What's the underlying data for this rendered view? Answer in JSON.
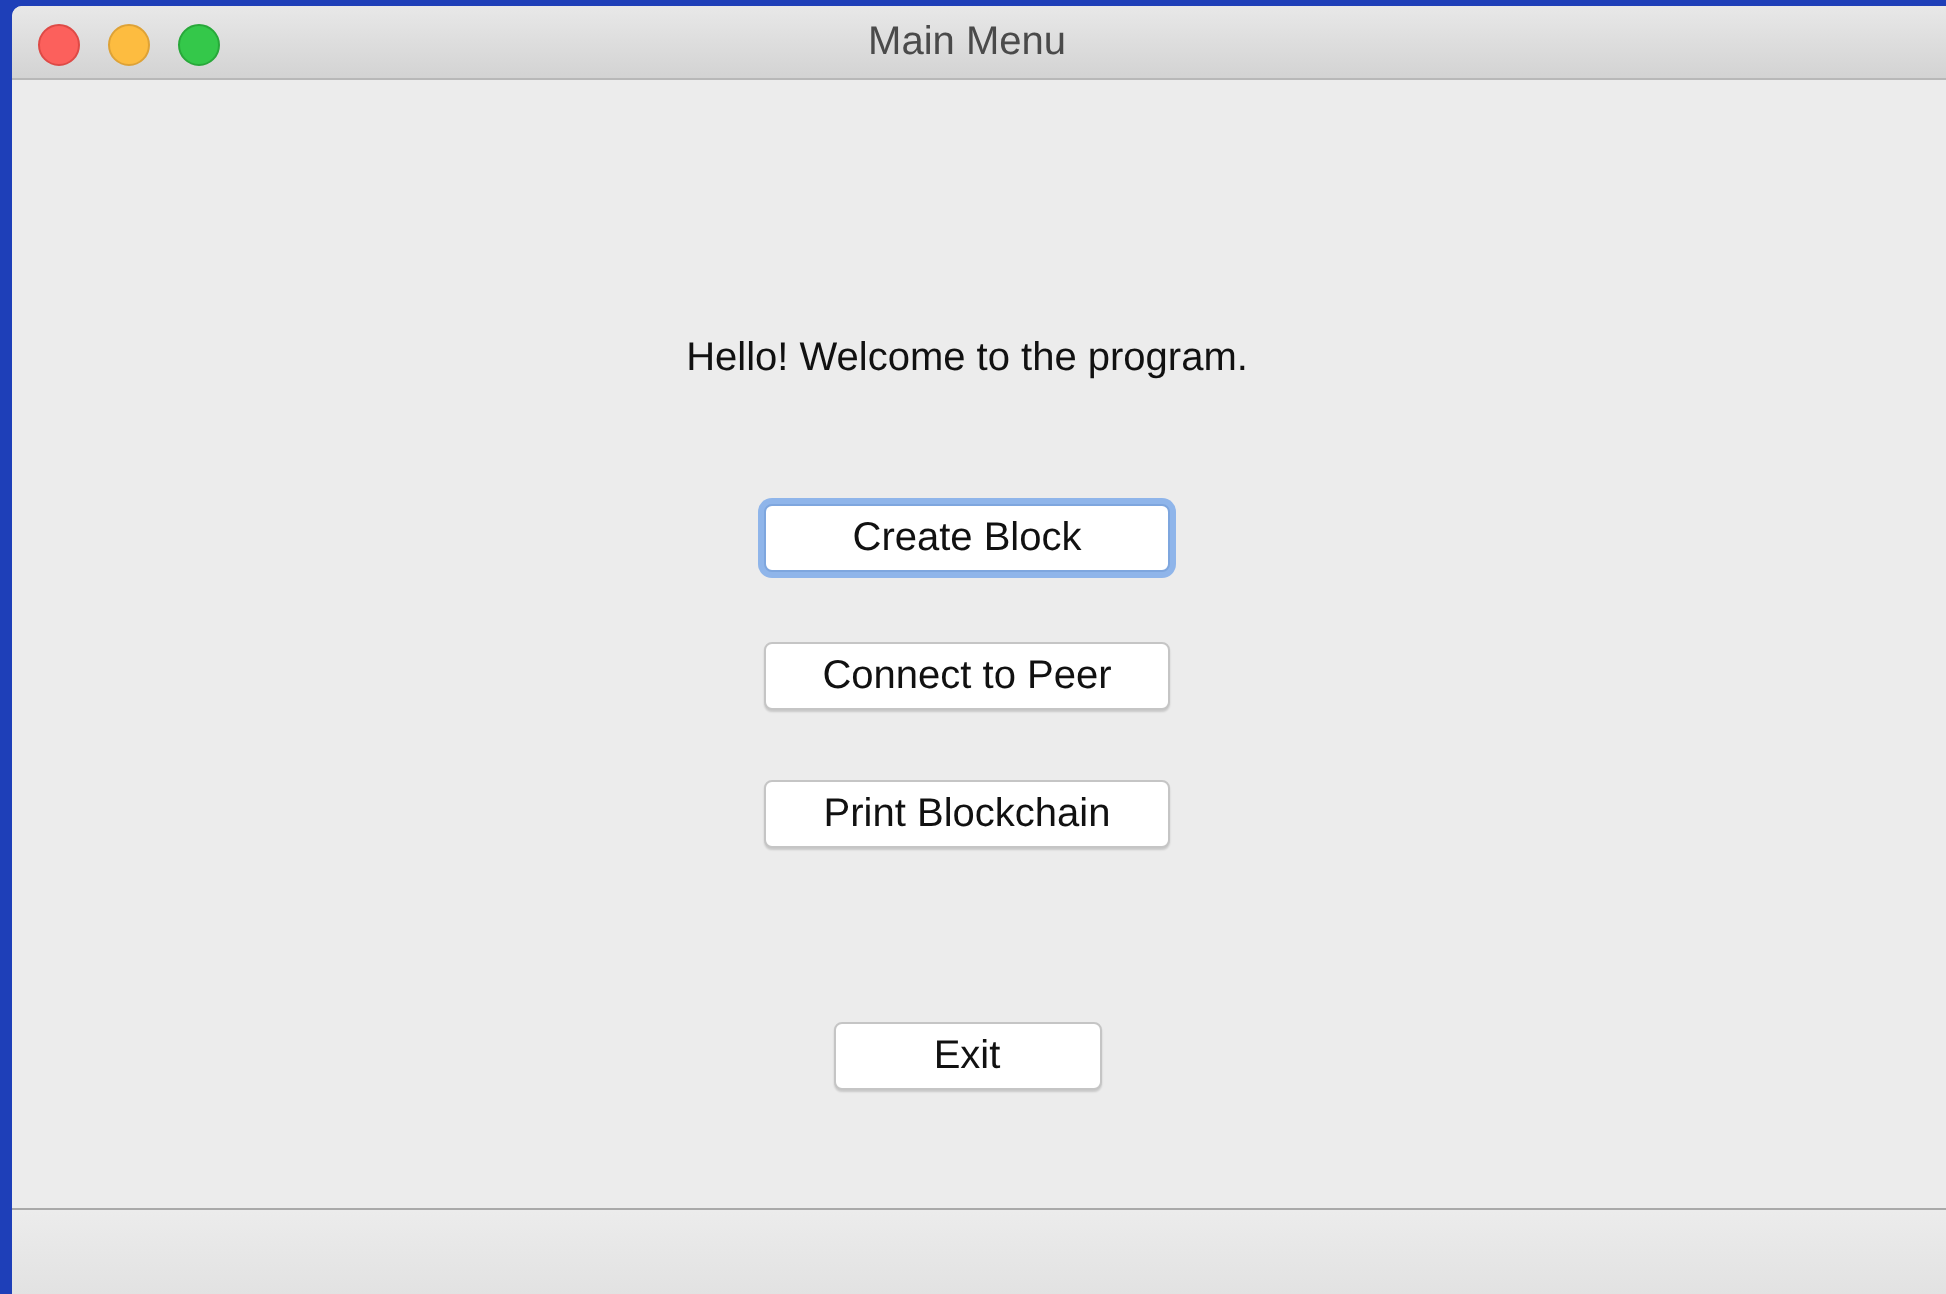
{
  "window": {
    "title": "Main Menu"
  },
  "message": "Hello! Welcome to the program.",
  "menu_buttons": [
    {
      "label": "Create Block",
      "focused": true
    },
    {
      "label": "Connect to Peer",
      "focused": false
    },
    {
      "label": "Print Blockchain",
      "focused": false
    }
  ],
  "exit_button": {
    "label": "Exit",
    "focused": false
  }
}
